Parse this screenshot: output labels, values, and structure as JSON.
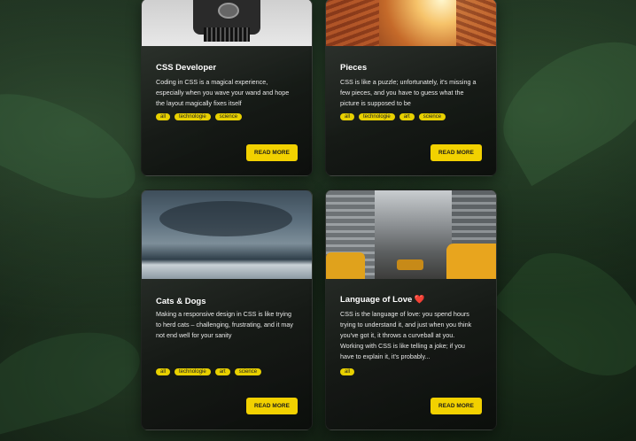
{
  "cards": [
    {
      "title": "CSS Developer",
      "text": "Coding in CSS is a magical experience, especially when you wave your wand and hope the layout magically fixes itself",
      "tags": [
        "all",
        "technologie",
        "science"
      ],
      "button": "READ MORE"
    },
    {
      "title": "Pieces",
      "text": "CSS is like a puzzle; unfortunately, it's missing a few pieces, and you have to guess what the picture is supposed to be",
      "tags": [
        "all",
        "technologie",
        "art",
        "science"
      ],
      "button": "READ MORE"
    },
    {
      "title": "Cats & Dogs",
      "text": "Making a responsive design in CSS is like trying to herd cats – challenging, frustrating, and it may not end well for your sanity",
      "tags": [
        "all",
        "technologie",
        "art",
        "science"
      ],
      "button": "READ MORE"
    },
    {
      "title": "Language of Love ❤️",
      "text": "CSS is the language of love: you spend hours trying to understand it, and just when you think you've got it, it throws a curveball at you. Working with CSS is like telling a joke; if you have to explain it, it's probably...",
      "tags": [
        "all"
      ],
      "button": "READ MORE"
    }
  ]
}
